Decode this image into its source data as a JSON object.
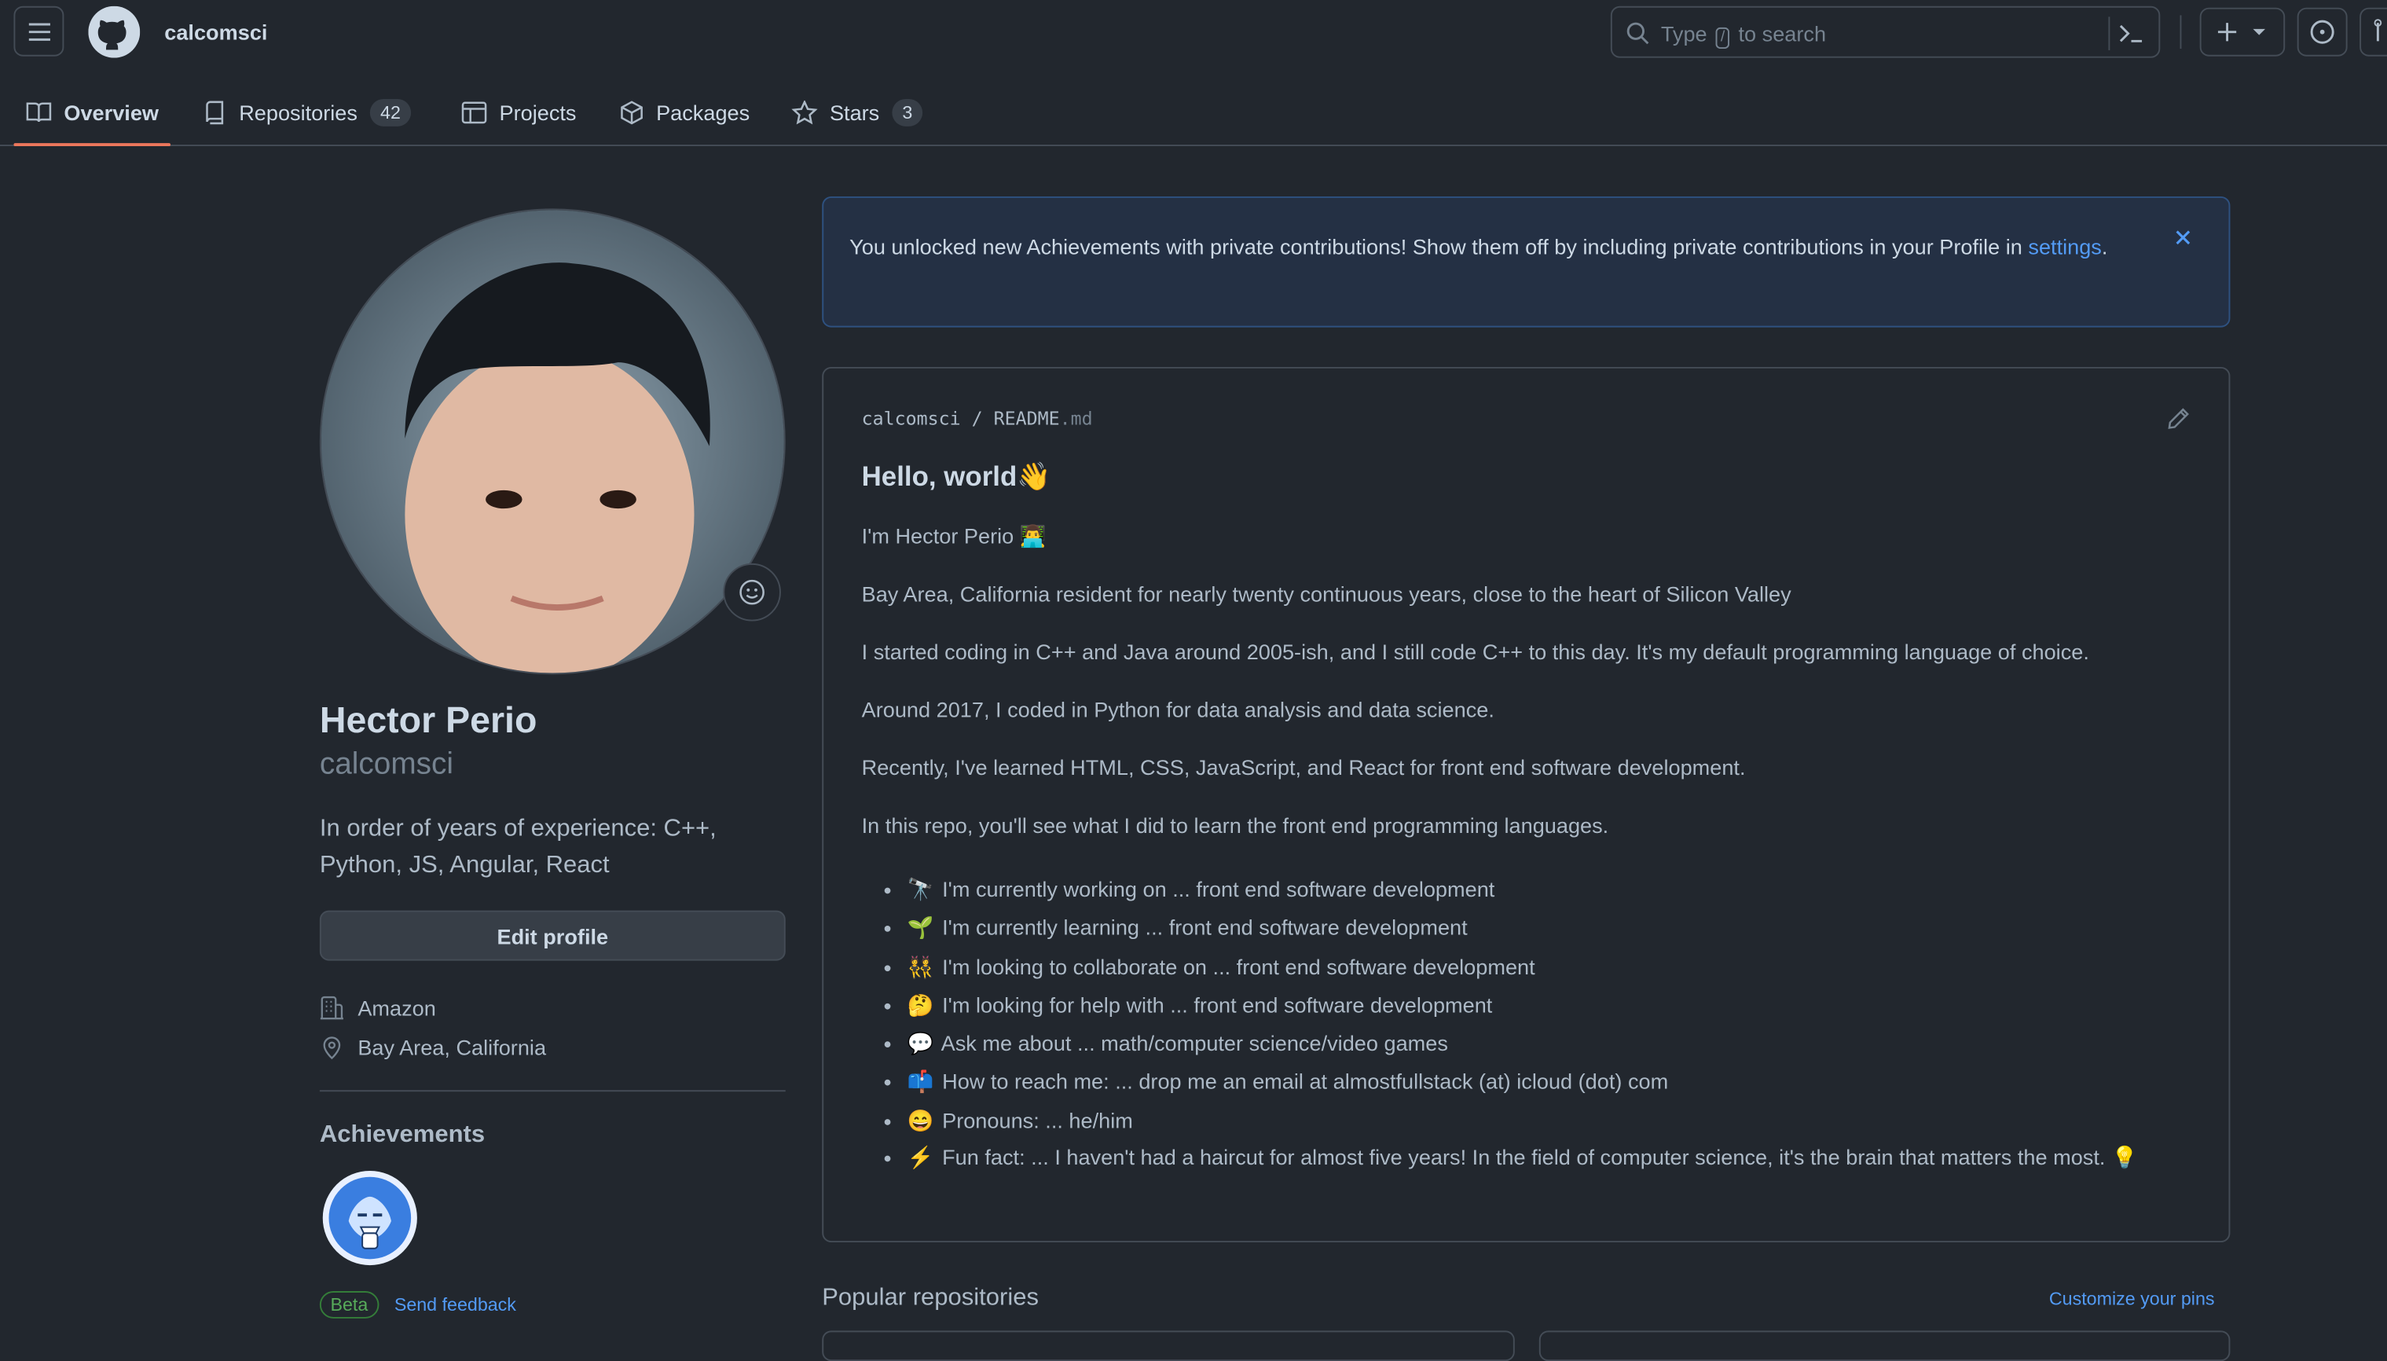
{
  "header": {
    "username": "calcomsci",
    "search_prefix": "Type",
    "search_key": "/",
    "search_suffix": "to search"
  },
  "tabs": [
    {
      "label": "Overview"
    },
    {
      "label": "Repositories",
      "count": "42"
    },
    {
      "label": "Projects"
    },
    {
      "label": "Packages"
    },
    {
      "label": "Stars",
      "count": "3"
    }
  ],
  "profile": {
    "name": "Hector Perio",
    "login": "calcomsci",
    "bio": "In order of years of experience: C++, Python, JS, Angular, React",
    "edit_label": "Edit profile",
    "company": "Amazon",
    "location": "Bay Area, California",
    "achievements_title": "Achievements",
    "beta_label": "Beta",
    "feedback_label": "Send feedback"
  },
  "flash": {
    "text": "You unlocked new Achievements with private contributions! Show them off by including private contributions in your Profile in",
    "link": "settings",
    "end": "."
  },
  "readme": {
    "owner": "calcomsci",
    "sep": "/",
    "file": "README",
    "ext": ".md",
    "heading": "Hello, world👋",
    "paragraphs": [
      "I'm Hector Perio 👨‍💻",
      "Bay Area, California resident for nearly twenty continuous years, close to the heart of Silicon Valley",
      "I started coding in C++ and Java around 2005-ish, and I still code C++ to this day. It's my default programming language of choice.",
      "Around 2017, I coded in Python for data analysis and data science.",
      "Recently, I've learned HTML, CSS, JavaScript, and React for front end software development.",
      "In this repo, you'll see what I did to learn the front end programming languages."
    ],
    "items": [
      {
        "emoji": "🔭",
        "text": "I'm currently working on ... front end software development"
      },
      {
        "emoji": "🌱",
        "text": "I'm currently learning ... front end software development"
      },
      {
        "emoji": "👯",
        "text": "I'm looking to collaborate on ... front end software development"
      },
      {
        "emoji": "🤔",
        "text": "I'm looking for help with ... front end software development"
      },
      {
        "emoji": "💬",
        "text": "Ask me about ... math/computer science/video games"
      },
      {
        "emoji": "📫",
        "text": "How to reach me: ... drop me an email at almostfullstack (at) icloud (dot) com"
      },
      {
        "emoji": "😄",
        "text": "Pronouns: ... he/him"
      },
      {
        "emoji": "⚡",
        "text": "Fun fact: ... I haven't had a haircut for almost five years! In the field of computer science, it's the brain that matters the most. 💡"
      }
    ]
  },
  "popular": {
    "title": "Popular repositories",
    "customize": "Customize your pins"
  },
  "colors": {
    "background": "#22272e",
    "border": "#444c56",
    "accent_link": "#539bf5",
    "tab_underline": "#ec775c",
    "flash_bg": "#243044"
  }
}
